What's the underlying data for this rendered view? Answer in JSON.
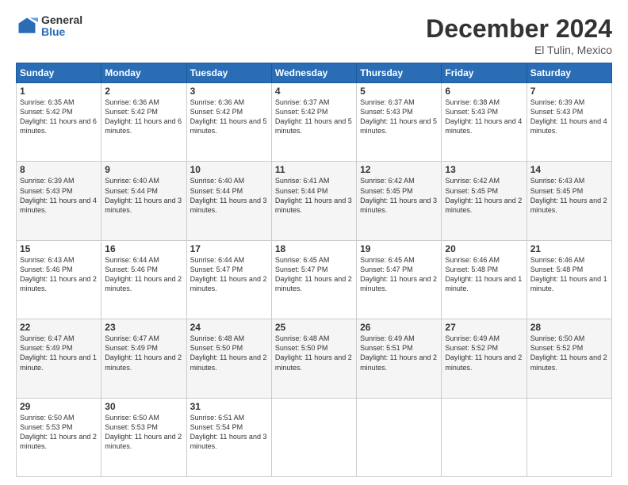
{
  "header": {
    "logo_general": "General",
    "logo_blue": "Blue",
    "month_title": "December 2024",
    "location": "El Tulin, Mexico"
  },
  "days_of_week": [
    "Sunday",
    "Monday",
    "Tuesday",
    "Wednesday",
    "Thursday",
    "Friday",
    "Saturday"
  ],
  "weeks": [
    [
      {
        "day": "1",
        "info": "Sunrise: 6:35 AM\nSunset: 5:42 PM\nDaylight: 11 hours and 6 minutes."
      },
      {
        "day": "2",
        "info": "Sunrise: 6:36 AM\nSunset: 5:42 PM\nDaylight: 11 hours and 6 minutes."
      },
      {
        "day": "3",
        "info": "Sunrise: 6:36 AM\nSunset: 5:42 PM\nDaylight: 11 hours and 5 minutes."
      },
      {
        "day": "4",
        "info": "Sunrise: 6:37 AM\nSunset: 5:42 PM\nDaylight: 11 hours and 5 minutes."
      },
      {
        "day": "5",
        "info": "Sunrise: 6:37 AM\nSunset: 5:43 PM\nDaylight: 11 hours and 5 minutes."
      },
      {
        "day": "6",
        "info": "Sunrise: 6:38 AM\nSunset: 5:43 PM\nDaylight: 11 hours and 4 minutes."
      },
      {
        "day": "7",
        "info": "Sunrise: 6:39 AM\nSunset: 5:43 PM\nDaylight: 11 hours and 4 minutes."
      }
    ],
    [
      {
        "day": "8",
        "info": "Sunrise: 6:39 AM\nSunset: 5:43 PM\nDaylight: 11 hours and 4 minutes."
      },
      {
        "day": "9",
        "info": "Sunrise: 6:40 AM\nSunset: 5:44 PM\nDaylight: 11 hours and 3 minutes."
      },
      {
        "day": "10",
        "info": "Sunrise: 6:40 AM\nSunset: 5:44 PM\nDaylight: 11 hours and 3 minutes."
      },
      {
        "day": "11",
        "info": "Sunrise: 6:41 AM\nSunset: 5:44 PM\nDaylight: 11 hours and 3 minutes."
      },
      {
        "day": "12",
        "info": "Sunrise: 6:42 AM\nSunset: 5:45 PM\nDaylight: 11 hours and 3 minutes."
      },
      {
        "day": "13",
        "info": "Sunrise: 6:42 AM\nSunset: 5:45 PM\nDaylight: 11 hours and 2 minutes."
      },
      {
        "day": "14",
        "info": "Sunrise: 6:43 AM\nSunset: 5:45 PM\nDaylight: 11 hours and 2 minutes."
      }
    ],
    [
      {
        "day": "15",
        "info": "Sunrise: 6:43 AM\nSunset: 5:46 PM\nDaylight: 11 hours and 2 minutes."
      },
      {
        "day": "16",
        "info": "Sunrise: 6:44 AM\nSunset: 5:46 PM\nDaylight: 11 hours and 2 minutes."
      },
      {
        "day": "17",
        "info": "Sunrise: 6:44 AM\nSunset: 5:47 PM\nDaylight: 11 hours and 2 minutes."
      },
      {
        "day": "18",
        "info": "Sunrise: 6:45 AM\nSunset: 5:47 PM\nDaylight: 11 hours and 2 minutes."
      },
      {
        "day": "19",
        "info": "Sunrise: 6:45 AM\nSunset: 5:47 PM\nDaylight: 11 hours and 2 minutes."
      },
      {
        "day": "20",
        "info": "Sunrise: 6:46 AM\nSunset: 5:48 PM\nDaylight: 11 hours and 1 minute."
      },
      {
        "day": "21",
        "info": "Sunrise: 6:46 AM\nSunset: 5:48 PM\nDaylight: 11 hours and 1 minute."
      }
    ],
    [
      {
        "day": "22",
        "info": "Sunrise: 6:47 AM\nSunset: 5:49 PM\nDaylight: 11 hours and 1 minute."
      },
      {
        "day": "23",
        "info": "Sunrise: 6:47 AM\nSunset: 5:49 PM\nDaylight: 11 hours and 2 minutes."
      },
      {
        "day": "24",
        "info": "Sunrise: 6:48 AM\nSunset: 5:50 PM\nDaylight: 11 hours and 2 minutes."
      },
      {
        "day": "25",
        "info": "Sunrise: 6:48 AM\nSunset: 5:50 PM\nDaylight: 11 hours and 2 minutes."
      },
      {
        "day": "26",
        "info": "Sunrise: 6:49 AM\nSunset: 5:51 PM\nDaylight: 11 hours and 2 minutes."
      },
      {
        "day": "27",
        "info": "Sunrise: 6:49 AM\nSunset: 5:52 PM\nDaylight: 11 hours and 2 minutes."
      },
      {
        "day": "28",
        "info": "Sunrise: 6:50 AM\nSunset: 5:52 PM\nDaylight: 11 hours and 2 minutes."
      }
    ],
    [
      {
        "day": "29",
        "info": "Sunrise: 6:50 AM\nSunset: 5:53 PM\nDaylight: 11 hours and 2 minutes."
      },
      {
        "day": "30",
        "info": "Sunrise: 6:50 AM\nSunset: 5:53 PM\nDaylight: 11 hours and 2 minutes."
      },
      {
        "day": "31",
        "info": "Sunrise: 6:51 AM\nSunset: 5:54 PM\nDaylight: 11 hours and 3 minutes."
      },
      {
        "day": "",
        "info": ""
      },
      {
        "day": "",
        "info": ""
      },
      {
        "day": "",
        "info": ""
      },
      {
        "day": "",
        "info": ""
      }
    ]
  ]
}
